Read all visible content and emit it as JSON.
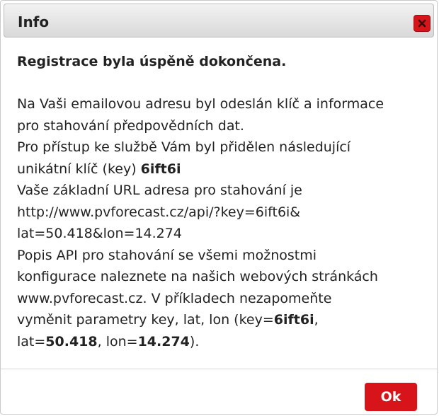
{
  "dialog": {
    "title": "Info",
    "close_icon": "close-icon",
    "heading": "Registrace byla úspěně dokončena.",
    "body": {
      "l1": "Na Vaši emailovou adresu byl odeslán klíč a informace",
      "l2": "pro stahování předpovědních dat.",
      "l3": "Pro přístup ke službě Vám byl přidělen následující",
      "l4_text": "unikátní klíč (key) ",
      "key": "6ift6i",
      "l5": "Vaše základní URL adresa pro stahování je",
      "l6": "http://www.pvforecast.cz/api/?key=6ift6i&",
      "l7": "lat=50.418&lon=14.274",
      "l8": "Popis API pro stahování se všemi možnostmi",
      "l9": "konfigurace naleznete na našich webových stránkách",
      "l10": "www.pvforecast.cz. V příkladech nezapomeňte",
      "l11_text": "vyměnit parametry key, lat, lon (key=",
      "l11_key": "6ift6i",
      "l11_end": ",",
      "l12_lat_label": "lat=",
      "lat": "50.418",
      "l12_mid": ", lon=",
      "lon": "14.274",
      "l12_end": ")."
    },
    "ok_label": "Ok"
  },
  "colors": {
    "accent": "#d7141a",
    "text": "#222222",
    "titlebar_top": "#f2f2f2",
    "titlebar_bottom": "#d9d9d9"
  }
}
